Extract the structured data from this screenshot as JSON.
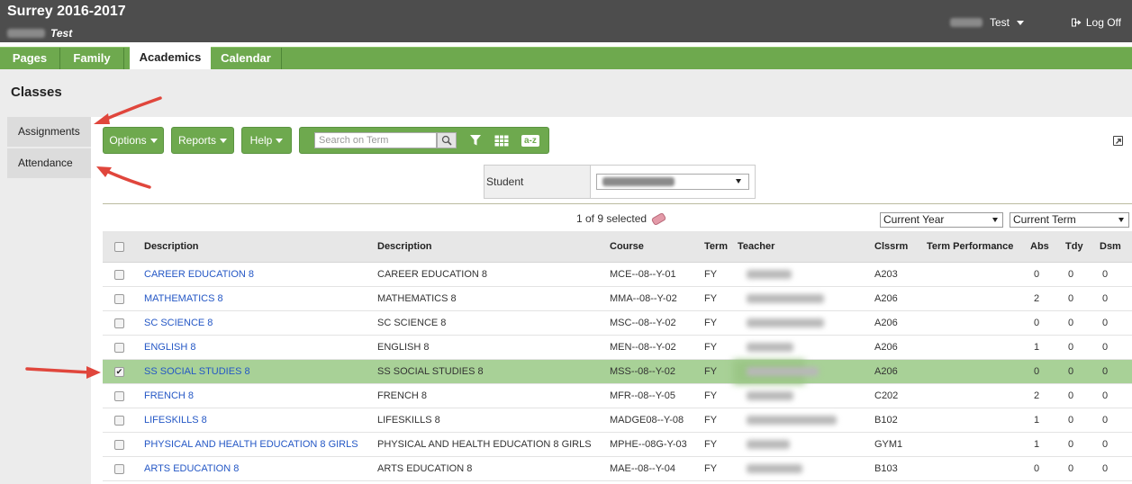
{
  "header": {
    "school_title": "Surrey 2016-2017",
    "sub_user": "Test",
    "user_menu_label": "Test",
    "logoff_label": "Log Off"
  },
  "topnav": {
    "tabs": [
      {
        "label": "Pages",
        "active": false
      },
      {
        "label": "Family",
        "active": false
      },
      {
        "label": "Academics",
        "active": true
      },
      {
        "label": "Calendar",
        "active": false
      }
    ]
  },
  "page": {
    "title": "Classes"
  },
  "sidenav": {
    "items": [
      {
        "label": "Assignments"
      },
      {
        "label": "Attendance"
      }
    ]
  },
  "toolbar": {
    "options_label": "Options",
    "reports_label": "Reports",
    "help_label": "Help",
    "search_placeholder": "Search on Term",
    "az_label": "a-z"
  },
  "student_selector": {
    "label": "Student"
  },
  "selection": {
    "count_text": "1 of 9 selected"
  },
  "filters": {
    "year": "Current Year",
    "term": "Current Term"
  },
  "table": {
    "columns": [
      "Description",
      "Description",
      "Course",
      "Term",
      "Teacher",
      "Clssrm",
      "Term Performance",
      "Abs",
      "Tdy",
      "Dsm"
    ],
    "rows": [
      {
        "desc": "CAREER EDUCATION 8",
        "desc2": "CAREER EDUCATION 8",
        "course": "MCE--08--Y-01",
        "term": "FY",
        "room": "A203",
        "abs": "0",
        "tdy": "0",
        "dsm": "0",
        "checked": false
      },
      {
        "desc": "MATHEMATICS 8",
        "desc2": "MATHEMATICS 8",
        "course": "MMA--08--Y-02",
        "term": "FY",
        "room": "A206",
        "abs": "2",
        "tdy": "0",
        "dsm": "0",
        "checked": false
      },
      {
        "desc": "SC SCIENCE 8",
        "desc2": "SC SCIENCE 8",
        "course": "MSC--08--Y-02",
        "term": "FY",
        "room": "A206",
        "abs": "0",
        "tdy": "0",
        "dsm": "0",
        "checked": false
      },
      {
        "desc": "ENGLISH 8",
        "desc2": "ENGLISH 8",
        "course": "MEN--08--Y-02",
        "term": "FY",
        "room": "A206",
        "abs": "1",
        "tdy": "0",
        "dsm": "0",
        "checked": false
      },
      {
        "desc": "SS SOCIAL STUDIES 8",
        "desc2": "SS SOCIAL STUDIES 8",
        "course": "MSS--08--Y-02",
        "term": "FY",
        "room": "A206",
        "abs": "0",
        "tdy": "0",
        "dsm": "0",
        "checked": true
      },
      {
        "desc": "FRENCH 8",
        "desc2": "FRENCH 8",
        "course": "MFR--08--Y-05",
        "term": "FY",
        "room": "C202",
        "abs": "2",
        "tdy": "0",
        "dsm": "0",
        "checked": false
      },
      {
        "desc": "LIFESKILLS 8",
        "desc2": "LIFESKILLS 8",
        "course": "MADGE08--Y-08",
        "term": "FY",
        "room": "B102",
        "abs": "1",
        "tdy": "0",
        "dsm": "0",
        "checked": false
      },
      {
        "desc": "PHYSICAL AND HEALTH EDUCATION 8 GIRLS",
        "desc2": "PHYSICAL AND HEALTH EDUCATION 8 GIRLS",
        "course": "MPHE--08G-Y-03",
        "term": "FY",
        "room": "GYM1",
        "abs": "1",
        "tdy": "0",
        "dsm": "0",
        "checked": false
      },
      {
        "desc": "ARTS EDUCATION 8",
        "desc2": "ARTS EDUCATION 8",
        "course": "MAE--08--Y-04",
        "term": "FY",
        "room": "B103",
        "abs": "0",
        "tdy": "0",
        "dsm": "0",
        "checked": false
      }
    ]
  },
  "colors": {
    "header_bg": "#4d4d4d",
    "nav_green": "#6ea94e",
    "highlight_row": "#a8d197",
    "link_blue": "#2457c5",
    "annotation_arrow": "#e0463c"
  }
}
